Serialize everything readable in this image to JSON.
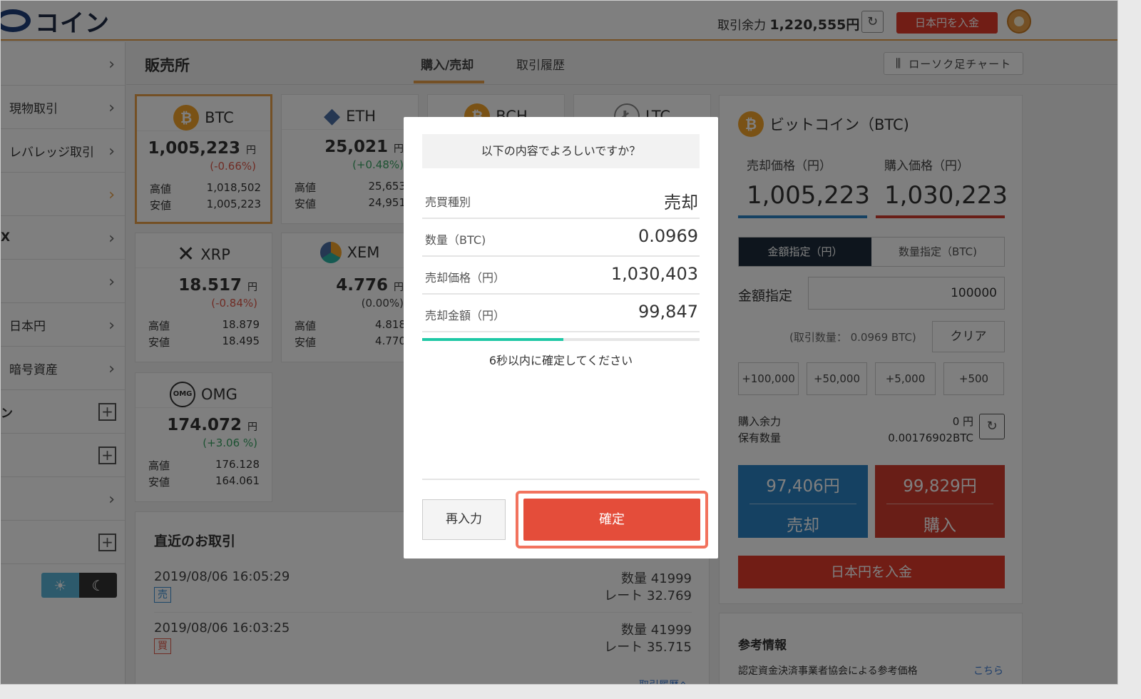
{
  "header": {
    "logo_text": "コイン",
    "balance_label": "取引余力",
    "balance_value": "1,220,555円",
    "deposit_label": "日本円を入金"
  },
  "sidebar": {
    "items": [
      {
        "label": "",
        "suffix": ">"
      },
      {
        "label": "現物取引",
        "suffix": ">"
      },
      {
        "label": "レバレッジ取引",
        "suffix": ">"
      },
      {
        "label": "",
        "suffix": ">"
      },
      {
        "label": "X",
        "suffix": ">"
      },
      {
        "label": "",
        "suffix": ">"
      },
      {
        "label": "日本円",
        "suffix": ">"
      },
      {
        "label": "暗号資産",
        "suffix": ">"
      },
      {
        "label": "ン",
        "suffix": "+"
      },
      {
        "label": "",
        "suffix": "+"
      },
      {
        "label": "",
        "suffix": ">"
      },
      {
        "label": "",
        "suffix": "+"
      }
    ]
  },
  "main": {
    "page_title": "販売所",
    "tabs": [
      {
        "label": "購入/売却",
        "active": true
      },
      {
        "label": "取引履歴",
        "active": false
      }
    ],
    "candle_button": "ローソク足チャート"
  },
  "coins": [
    {
      "symbol": "BTC",
      "icon": "btc-icon",
      "price": "1,005,223",
      "unit": "円",
      "change": "(-0.66%)",
      "change_color": "#e05a4b",
      "high_label": "高値",
      "high": "1,018,502",
      "low_label": "安値",
      "low": "1,005,223"
    },
    {
      "symbol": "ETH",
      "icon": "eth-icon",
      "price": "25,021",
      "unit": "円",
      "change": "(+0.48%)",
      "change_color": "#3aa564",
      "high_label": "高値",
      "high": "25,653",
      "low_label": "安値",
      "low": "24,951"
    },
    {
      "symbol": "BCH",
      "icon": "bch-icon"
    },
    {
      "symbol": "LTC",
      "icon": "ltc-icon"
    },
    {
      "symbol": "XRP",
      "icon": "xrp-icon",
      "price": "18.517",
      "unit": "円",
      "change": "(-0.84%)",
      "change_color": "#e05a4b",
      "high_label": "高値",
      "high": "18.879",
      "low_label": "安値",
      "low": "18.495"
    },
    {
      "symbol": "XEM",
      "icon": "xem-icon",
      "price": "4.776",
      "unit": "円",
      "change": "(0.00%)",
      "change_color": "#444444",
      "high_label": "高値",
      "high": "4.818",
      "low_label": "安値",
      "low": "4.770"
    },
    {
      "symbol": "OMG",
      "icon": "omg-icon",
      "price": "174.072",
      "unit": "円",
      "change": "(+3.06 %)",
      "change_color": "#3aa564",
      "high_label": "高値",
      "high": "176.128",
      "low_label": "安値",
      "low": "164.061"
    }
  ],
  "recent": {
    "title": "直近のお取引",
    "rows": [
      {
        "date": "2019/08/06 16:05:29",
        "type": "売",
        "type_color": "#3a8fd5",
        "qty": "数量 41999",
        "rate": "レート 32.769"
      },
      {
        "date": "2019/08/06 16:03:25",
        "type": "買",
        "type_color": "#e05a4b",
        "qty": "数量 41999",
        "rate": "レート 35.715"
      }
    ],
    "more": "取引履歴へ"
  },
  "right_panel": {
    "title": "ビットコイン（BTC)",
    "sell_price_label": "売却価格（円）",
    "sell_price": "1,005,223",
    "buy_price_label": "購入価格（円）",
    "buy_price": "1,030,223",
    "mode_amount": "金額指定（円）",
    "mode_qty": "数量指定（BTC)",
    "amount_label": "金額指定",
    "amount_value": "100000",
    "qty_text": "(取引数量： 0.0969 BTC)",
    "clear_label": "クリア",
    "quick": [
      "+100,000",
      "+50,000",
      "+5,000",
      "+500"
    ],
    "buying_power_label": "購入余力",
    "buying_power": "0 円",
    "holdings_label": "保有数量",
    "holdings": "0.00176902BTC",
    "sell_amount": "97,406円",
    "sell_label": "売却",
    "buy_amount": "99,829円",
    "buy_label": "購入",
    "deposit_label": "日本円を入金"
  },
  "reference": {
    "title": "参考情報",
    "text": "認定資金決済事業者協会による参考価格",
    "link": "こちら"
  },
  "modal": {
    "question": "以下の内容でよろしいですか？",
    "rows": [
      {
        "label": "売買種別",
        "value": "売却"
      },
      {
        "label": "数量（BTC)",
        "value": "0.0969"
      },
      {
        "label": "売却価格（円）",
        "value": "1,030,403"
      },
      {
        "label": "売却金額（円）",
        "value": "99,847"
      }
    ],
    "timer_progress": 0.51,
    "timer_text": "6秒以内に確定してください",
    "reenter_label": "再入力",
    "confirm_label": "確定"
  },
  "colors": {
    "accent_orange": "#e8a14b",
    "red": "#e23a2b",
    "sell_blue": "#2a82c4",
    "buy_red": "#d23c2f",
    "timer_green": "#1ec8a5"
  }
}
